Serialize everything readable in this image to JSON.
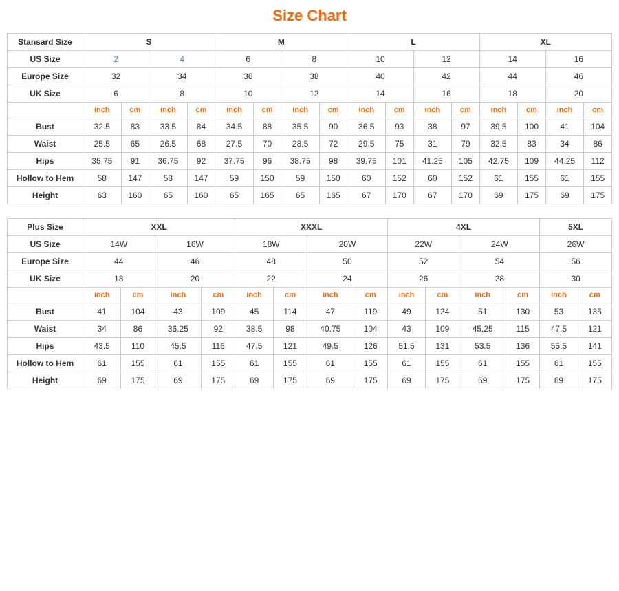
{
  "title": "Size Chart",
  "standard": {
    "label": "Stansard Size",
    "sizeGroups": [
      "S",
      "M",
      "L",
      "XL"
    ],
    "usLabel": "US Size",
    "usValues": [
      "2",
      "4",
      "6",
      "8",
      "10",
      "12",
      "14",
      "16"
    ],
    "euroLabel": "Europe Size",
    "euroValues": [
      "32",
      "34",
      "36",
      "38",
      "40",
      "42",
      "44",
      "46"
    ],
    "ukLabel": "UK Size",
    "ukValues": [
      "6",
      "8",
      "10",
      "12",
      "14",
      "16",
      "18",
      "20"
    ],
    "unitRow": [
      "inch",
      "cm",
      "inch",
      "cm",
      "inch",
      "cm",
      "inch",
      "cm",
      "inch",
      "cm",
      "inch",
      "cm",
      "inch",
      "cm",
      "inch",
      "cm"
    ],
    "measurements": [
      {
        "label": "Bust",
        "values": [
          "32.5",
          "83",
          "33.5",
          "84",
          "34.5",
          "88",
          "35.5",
          "90",
          "36.5",
          "93",
          "38",
          "97",
          "39.5",
          "100",
          "41",
          "104"
        ]
      },
      {
        "label": "Waist",
        "values": [
          "25.5",
          "65",
          "26.5",
          "68",
          "27.5",
          "70",
          "28.5",
          "72",
          "29.5",
          "75",
          "31",
          "79",
          "32.5",
          "83",
          "34",
          "86"
        ]
      },
      {
        "label": "Hips",
        "values": [
          "35.75",
          "91",
          "36.75",
          "92",
          "37.75",
          "96",
          "38.75",
          "98",
          "39.75",
          "101",
          "41.25",
          "105",
          "42.75",
          "109",
          "44.25",
          "112"
        ]
      },
      {
        "label": "Hollow to Hem",
        "values": [
          "58",
          "147",
          "58",
          "147",
          "59",
          "150",
          "59",
          "150",
          "60",
          "152",
          "60",
          "152",
          "61",
          "155",
          "61",
          "155"
        ]
      },
      {
        "label": "Height",
        "values": [
          "63",
          "160",
          "65",
          "160",
          "65",
          "165",
          "65",
          "165",
          "67",
          "170",
          "67",
          "170",
          "69",
          "175",
          "69",
          "175"
        ]
      }
    ]
  },
  "plus": {
    "label": "Plus Size",
    "sizeGroups": [
      "XXL",
      "XXXL",
      "4XL",
      "5XL"
    ],
    "usLabel": "US Size",
    "usValues": [
      "14W",
      "16W",
      "18W",
      "20W",
      "22W",
      "24W",
      "26W"
    ],
    "euroLabel": "Europe Size",
    "euroValues": [
      "44",
      "46",
      "48",
      "50",
      "52",
      "54",
      "56"
    ],
    "ukLabel": "UK Size",
    "ukValues": [
      "18",
      "20",
      "22",
      "24",
      "26",
      "28",
      "30"
    ],
    "unitRow": [
      "inch",
      "cm",
      "inch",
      "cm",
      "inch",
      "cm",
      "inch",
      "cm",
      "inch",
      "cm",
      "inch",
      "cm",
      "inch",
      "cm"
    ],
    "measurements": [
      {
        "label": "Bust",
        "values": [
          "41",
          "104",
          "43",
          "109",
          "45",
          "114",
          "47",
          "119",
          "49",
          "124",
          "51",
          "130",
          "53",
          "135"
        ]
      },
      {
        "label": "Waist",
        "values": [
          "34",
          "86",
          "36.25",
          "92",
          "38.5",
          "98",
          "40.75",
          "104",
          "43",
          "109",
          "45.25",
          "115",
          "47.5",
          "121"
        ]
      },
      {
        "label": "Hips",
        "values": [
          "43.5",
          "110",
          "45.5",
          "116",
          "47.5",
          "121",
          "49.5",
          "126",
          "51.5",
          "131",
          "53.5",
          "136",
          "55.5",
          "141"
        ]
      },
      {
        "label": "Hollow to Hem",
        "values": [
          "61",
          "155",
          "61",
          "155",
          "61",
          "155",
          "61",
          "155",
          "61",
          "155",
          "61",
          "155",
          "61",
          "155"
        ]
      },
      {
        "label": "Height",
        "values": [
          "69",
          "175",
          "69",
          "175",
          "69",
          "175",
          "69",
          "175",
          "69",
          "175",
          "69",
          "175",
          "69",
          "175"
        ]
      }
    ]
  }
}
